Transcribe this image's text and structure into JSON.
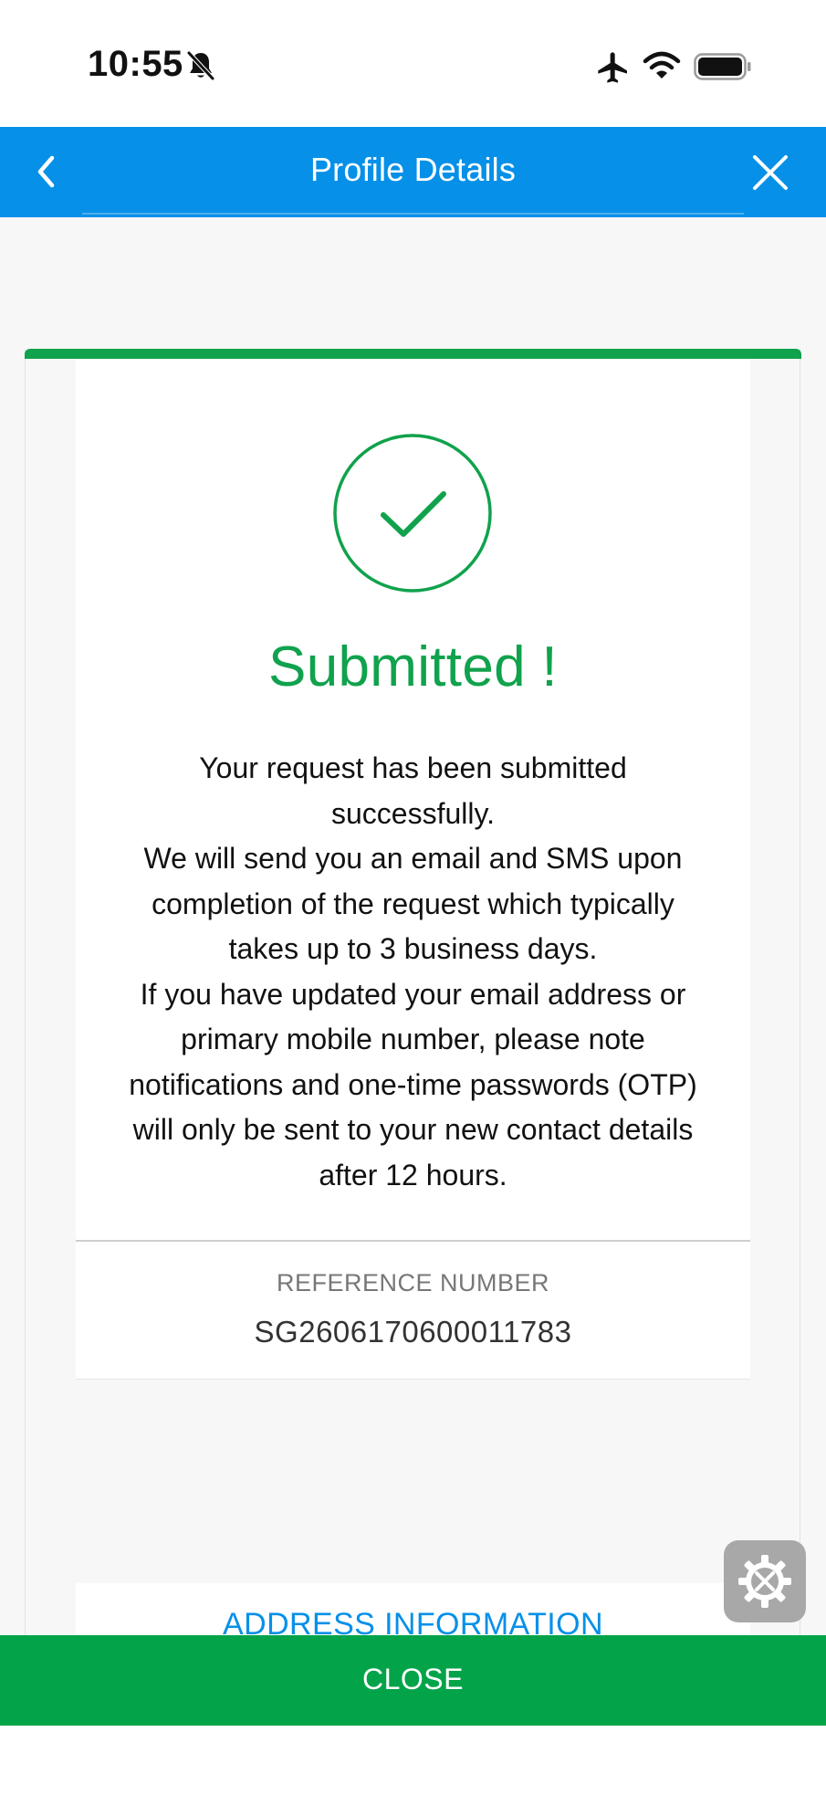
{
  "status_bar": {
    "time": "10:55",
    "icons": [
      "bell-off-icon",
      "airplane-icon",
      "wifi-icon",
      "battery-icon"
    ]
  },
  "header": {
    "title": "Profile Details",
    "back_icon": "chevron-left-icon",
    "close_icon": "close-icon"
  },
  "result": {
    "heading": "Submitted !",
    "message_lines": [
      "Your request has been submitted",
      "successfully.",
      "We will send you an email and SMS upon",
      "completion of the request which typically",
      "takes up to 3 business days.",
      "If you have updated your email address or",
      "primary mobile number, please note",
      "notifications and one-time passwords (OTP)",
      "will only be sent to your new contact details",
      "after 12 hours."
    ],
    "reference_label": "REFERENCE NUMBER",
    "reference_number": "SG2606170600011783"
  },
  "sections": {
    "address_link": "ADDRESS INFORMATION"
  },
  "footer": {
    "close_label": "CLOSE"
  },
  "colors": {
    "header_blue": "#0690e8",
    "success_green": "#10a24c",
    "close_bar_green": "#03a349"
  }
}
